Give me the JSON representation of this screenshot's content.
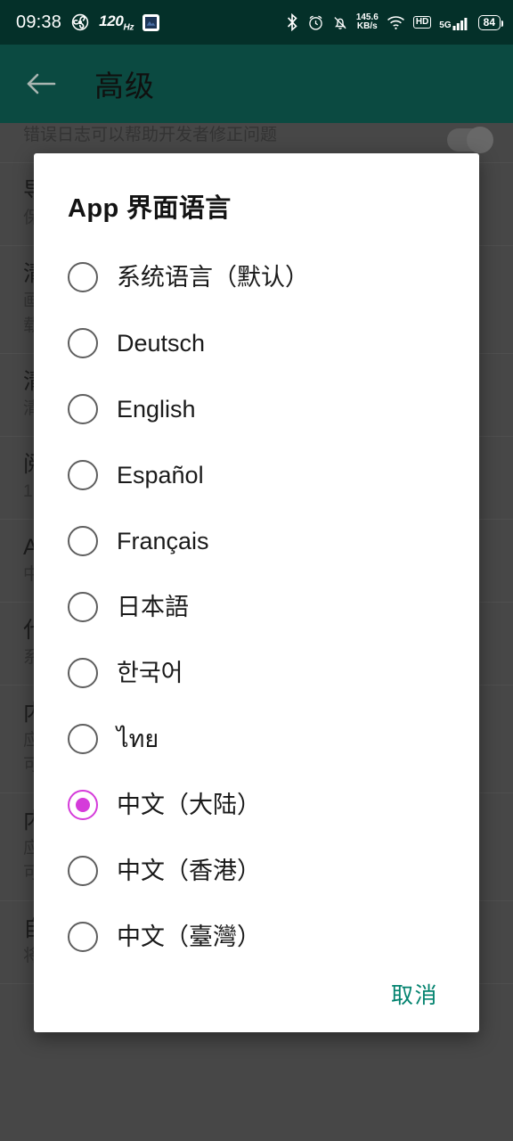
{
  "status_bar": {
    "time": "09:38",
    "refresh_rate": "120",
    "refresh_rate_unit": "Hz",
    "fan_icon": "fan-icon",
    "screenshot_icon": "screenshot-thumbnail-icon",
    "bluetooth_icon": "bluetooth-icon",
    "alarm_icon": "alarm-clock-icon",
    "mute_icon": "bell-muted-icon",
    "net_speed_value": "145.6",
    "net_speed_unit": "KB/s",
    "wifi_icon": "wifi-icon",
    "hd_label": "HD",
    "network_type": "5G",
    "signal_icon": "signal-bars-icon",
    "battery_level": "84"
  },
  "app_bar": {
    "back_icon": "back-arrow-icon",
    "title": "高级"
  },
  "background_rows": [
    {
      "title": "",
      "subtitle": "错误日志可以帮助开发者修正问题",
      "has_switch": true
    },
    {
      "title": "导出日志",
      "subtitle": "保存错误日志到文件",
      "has_switch": false
    },
    {
      "title": "清除图片缓存",
      "subtitle": "画廊缓存的图片",
      "subtitle2": "载入图片时会再次缓存",
      "has_switch": false
    },
    {
      "title": "清除网络缓存",
      "subtitle": "清除网络请求的缓存数据",
      "has_switch": false
    },
    {
      "title": "阅读缓存大小",
      "subtitle": "1",
      "has_switch": false
    },
    {
      "title": "App 界面语言",
      "subtitle": "中文（大陆）",
      "has_switch": false
    },
    {
      "title": "代理设置",
      "subtitle": "系统代理",
      "has_switch": false
    },
    {
      "title": "内置 hosts.txt",
      "subtitle": "应用内置的 hosts 列表",
      "subtitle2": "可被自定义 hosts.txt 覆盖",
      "has_switch": false
    },
    {
      "title": "内置 hosts.txt",
      "subtitle": "应用内置的 hosts 列表",
      "subtitle2": "可被自定义 hosts.txt 覆盖",
      "has_switch": false
    },
    {
      "title": "自定义 hosts.txt",
      "subtitle": "将主机名称映射到相应的IP地址",
      "has_switch": false
    }
  ],
  "dialog": {
    "title": "App 界面语言",
    "cancel_label": "取消",
    "accent_selected_color": "#d53bda",
    "cancel_color": "#03836f",
    "options": [
      {
        "label": "系统语言（默认）",
        "selected": false
      },
      {
        "label": "Deutsch",
        "selected": false
      },
      {
        "label": "English",
        "selected": false
      },
      {
        "label": "Español",
        "selected": false
      },
      {
        "label": "Français",
        "selected": false
      },
      {
        "label": "日本語",
        "selected": false
      },
      {
        "label": "한국어",
        "selected": false
      },
      {
        "label": "ไทย",
        "selected": false
      },
      {
        "label": "中文（大陆）",
        "selected": true
      },
      {
        "label": "中文（香港）",
        "selected": false
      },
      {
        "label": "中文（臺灣）",
        "selected": false
      }
    ]
  },
  "colors": {
    "status_bar_bg": "#043029",
    "app_bar_bg": "#0b4a41",
    "scrim": "#6a6a6a",
    "dialog_bg": "#ffffff"
  }
}
